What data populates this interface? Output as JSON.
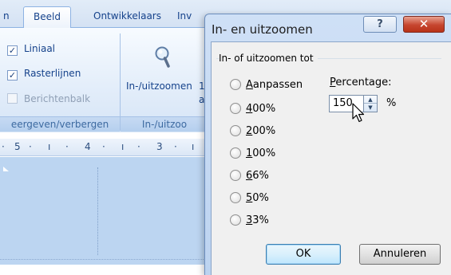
{
  "ribbon": {
    "tabs": [
      {
        "label": "Beeld",
        "active": true
      },
      {
        "label": "Ontwikkelaars",
        "active": false
      },
      {
        "label": "Inv",
        "active": false
      }
    ],
    "tab_partial_left": "n",
    "show_group": {
      "checkboxes": [
        {
          "label": "Liniaal",
          "checked": true,
          "enabled": true
        },
        {
          "label": "Rasterlijnen",
          "checked": true,
          "enabled": true
        },
        {
          "label": "Berichtenbalk",
          "checked": false,
          "enabled": false
        }
      ],
      "footer": "eergeven/verbergen"
    },
    "zoom_group": {
      "button_label": "In-/uitzoomen",
      "button_extra_1": "1",
      "button_extra_2": "a",
      "footer": "In-/uitzoo"
    },
    "ruler_numbers": [
      "5",
      "4",
      "3"
    ]
  },
  "dialog": {
    "title": "In- en uitzoomen",
    "help_icon": "question-mark",
    "close_icon": "x",
    "group_label": "In- of uitzoomen tot",
    "options": [
      {
        "label": "Aanpassen",
        "accel": "A",
        "rest": "anpassen"
      },
      {
        "label": "400%",
        "accel": "4",
        "rest": "00%"
      },
      {
        "label": "200%",
        "accel": "2",
        "rest": "00%"
      },
      {
        "label": "100%",
        "accel": "1",
        "rest": "00%"
      },
      {
        "label": "66%",
        "accel": "6",
        "rest": "6%"
      },
      {
        "label": "50%",
        "accel": "5",
        "rest": "0%"
      },
      {
        "label": "33%",
        "accel": "3",
        "rest": "3%"
      }
    ],
    "percentage_label": "Percentage:",
    "percentage_accel": "P",
    "percentage_rest": "ercentage:",
    "percentage_value": "150",
    "percentage_unit": "%",
    "ok_label": "OK",
    "cancel_label": "Annuleren"
  },
  "colors": {
    "ribbon_text": "#15428b",
    "ribbon_bg": "#dbe7f6",
    "dialog_frame": "#bcd3f0",
    "close_button": "#c6452f",
    "document_bg": "#bcd5f1"
  }
}
